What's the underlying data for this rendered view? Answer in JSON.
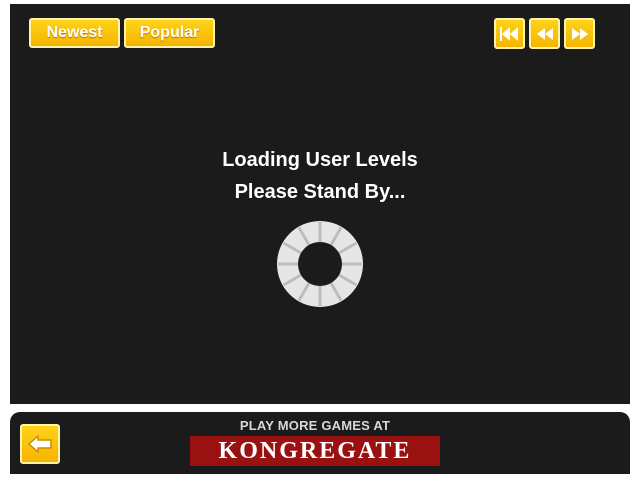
{
  "tabs": {
    "newest_label": "Newest",
    "popular_label": "Popular"
  },
  "nav": {
    "first_icon": "double-rewind-icon",
    "prev_icon": "rewind-icon",
    "next_icon": "fast-forward-icon"
  },
  "loading": {
    "line1": "Loading User Levels",
    "line2": "Please Stand By..."
  },
  "footer": {
    "back_icon": "back-arrow-icon",
    "promo": "PLAY MORE GAMES AT",
    "logo_text": "KONGREGATE"
  },
  "colors": {
    "panel": "#1b1b1b",
    "button": "#f9c10c",
    "logo": "#9a1111",
    "spinner": "#e6e6e6"
  }
}
